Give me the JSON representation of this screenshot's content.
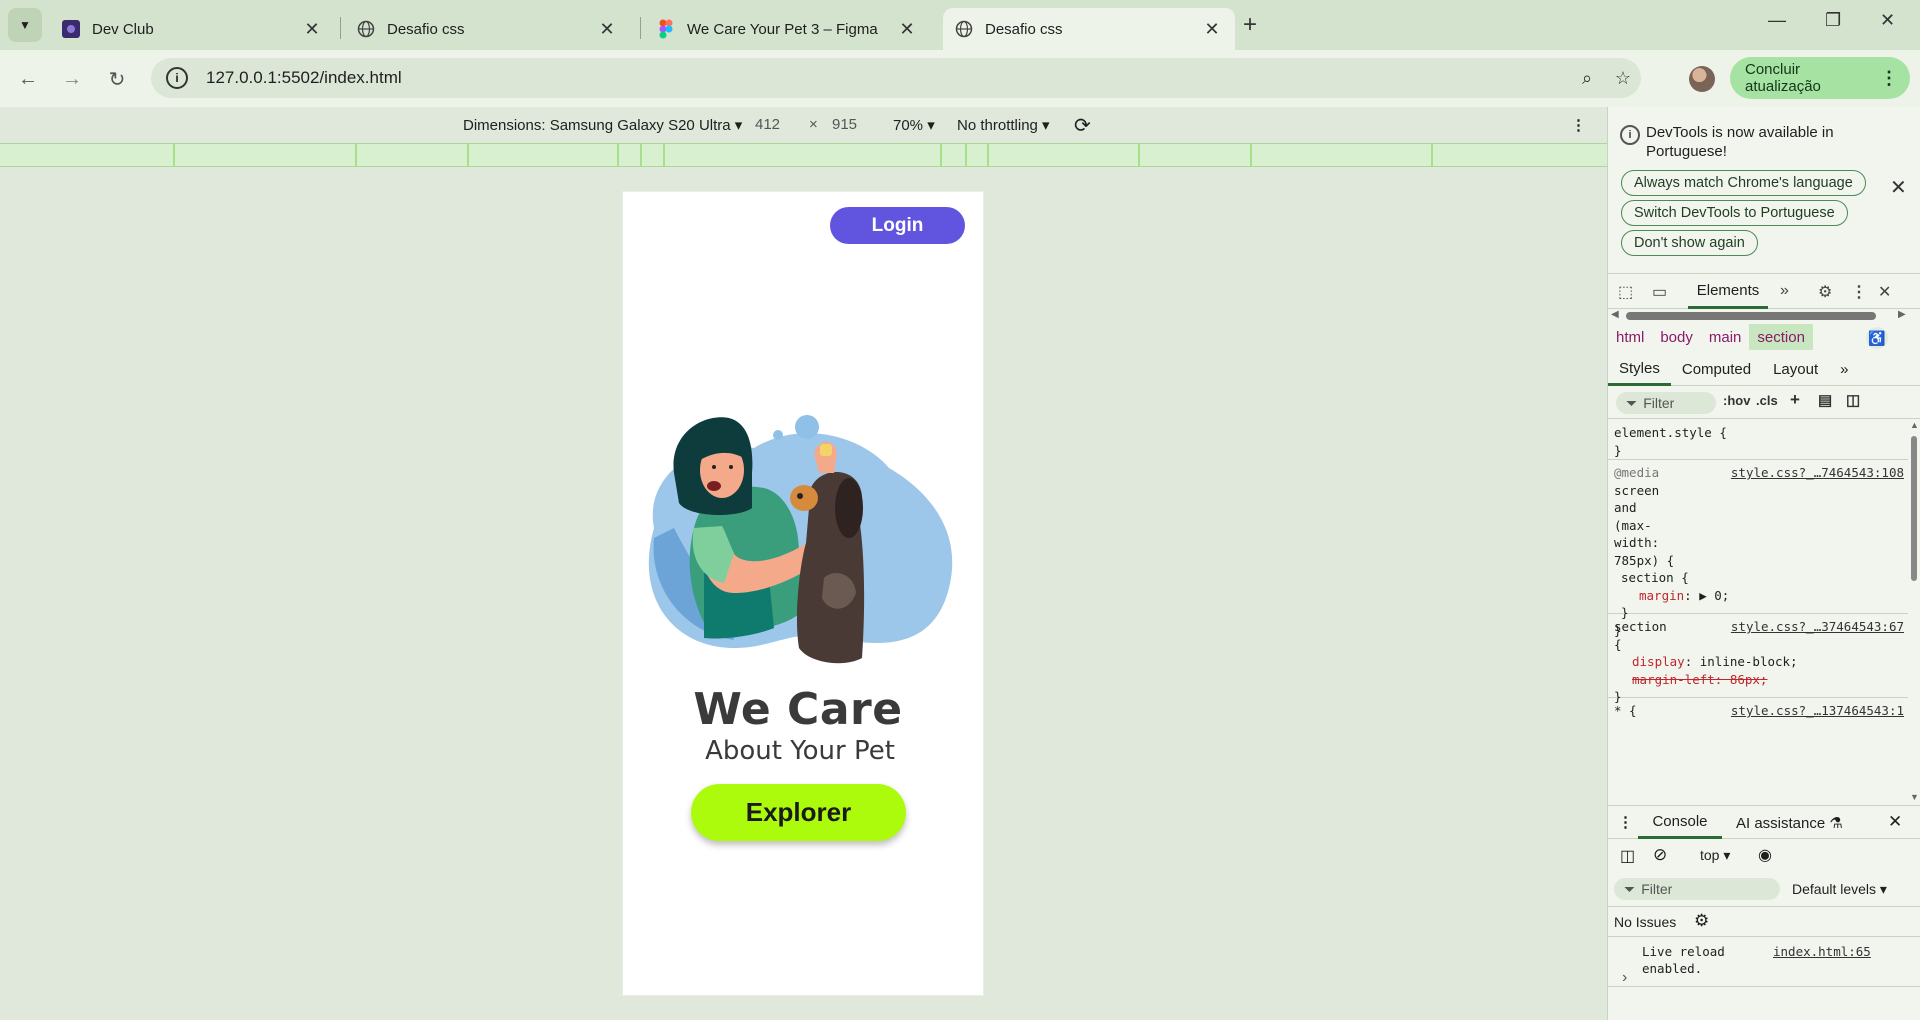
{
  "browser": {
    "tabs": [
      {
        "title": "Dev Club",
        "favicon": "devclub-icon"
      },
      {
        "title": "Desafio css",
        "favicon": "globe-icon"
      },
      {
        "title": "We Care Your Pet 3 – Figma",
        "favicon": "figma-icon"
      },
      {
        "title": "Desafio css",
        "favicon": "globe-icon",
        "active": true
      }
    ],
    "url": "127.0.0.1:5502/index.html",
    "update_button": "Concluir atualização"
  },
  "device_toolbar": {
    "dimensions_label": "Dimensions: Samsung Galaxy S20 Ultra",
    "width": "412",
    "times": "×",
    "height": "915",
    "zoom": "70%",
    "throttling": "No throttling"
  },
  "page": {
    "login": "Login",
    "headline_big": "We Care",
    "headline_small": "About Your Pet",
    "explore": "Explorer",
    "colors": {
      "login_bg": "#6155e0",
      "explore_bg": "#adfb0c",
      "text": "#3a3a3a"
    }
  },
  "devtools": {
    "notice": "DevTools is now available in Portuguese!",
    "notice_buttons": [
      "Always match Chrome's language",
      "Switch DevTools to Portuguese",
      "Don't show again"
    ],
    "main_tab": "Elements",
    "breadcrumbs": [
      "html",
      "body",
      "main",
      "section"
    ],
    "subtabs": [
      "Styles",
      "Computed",
      "Layout"
    ],
    "filter_placeholder": "Filter",
    "hov": ":hov",
    "cls": ".cls",
    "styles": {
      "element_style": "element.style {",
      "close_brace": "}",
      "media_at": "@media",
      "media_lines": [
        "screen",
        "and",
        "(max-",
        "width:",
        "785px) {"
      ],
      "media_source": "style.css?_…7464543:108",
      "media_selector": "section {",
      "media_prop": "margin",
      "media_value": "0;",
      "section_selector": "section",
      "section_open": "{",
      "section_source": "style.css?_…37464543:67",
      "display_prop": "display",
      "display_value": "inline-block;",
      "margin_left_decl": "margin-left: 86px;",
      "star_selector": "* {",
      "star_source": "style.css?_…137464543:1"
    },
    "console": {
      "tab": "Console",
      "ai_tab": "AI assistance",
      "context": "top",
      "filter_placeholder": "Filter",
      "levels": "Default levels",
      "issues": "No Issues",
      "log_text_1": "Live reload",
      "log_text_2": "enabled.",
      "log_source": "index.html:65",
      "prompt": "›"
    }
  }
}
